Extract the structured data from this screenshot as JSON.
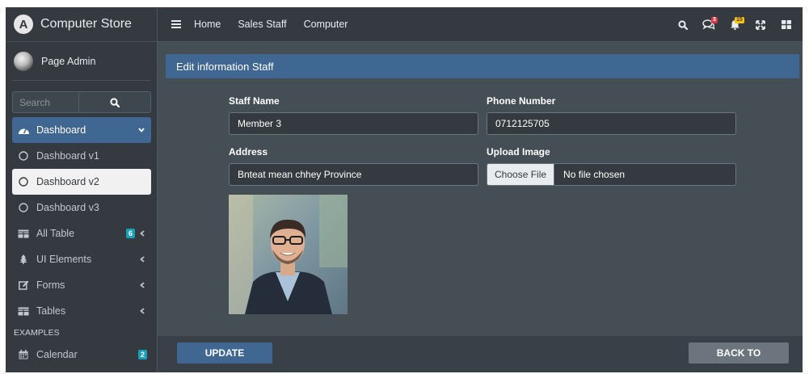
{
  "brand": {
    "name": "Computer Store",
    "logo_letter": "A"
  },
  "user": {
    "name": "Page Admin"
  },
  "search": {
    "placeholder": "Search"
  },
  "nav": {
    "dashboard": "Dashboard",
    "dashboard_v1": "Dashboard v1",
    "dashboard_v2": "Dashboard v2",
    "dashboard_v3": "Dashboard v3",
    "all_table": "All Table",
    "all_table_badge": "6",
    "ui_elements": "UI Elements",
    "forms": "Forms",
    "tables": "Tables",
    "examples_header": "EXAMPLES",
    "calendar": "Calendar",
    "calendar_badge": "2"
  },
  "topbar": {
    "links": [
      "Home",
      "Sales Staff",
      "Computer"
    ],
    "messages_badge": "3",
    "notifications_badge": "15"
  },
  "form": {
    "title": "Edit information Staff",
    "staff_name_label": "Staff Name",
    "staff_name_value": "Member 3",
    "phone_label": "Phone Number",
    "phone_value": "0712125705",
    "address_label": "Address",
    "address_value": "Bnteat mean chhey Province",
    "upload_label": "Upload Image",
    "choose_file": "Choose File",
    "no_file": "No file chosen"
  },
  "buttons": {
    "update": "UPDATE",
    "back": "BACK TO"
  },
  "colors": {
    "accent": "#3f6791",
    "sidebar": "#343a40",
    "content": "#454d55",
    "badge_info": "#17a2b8",
    "badge_danger": "#dc3545",
    "badge_warning": "#ffc107"
  }
}
